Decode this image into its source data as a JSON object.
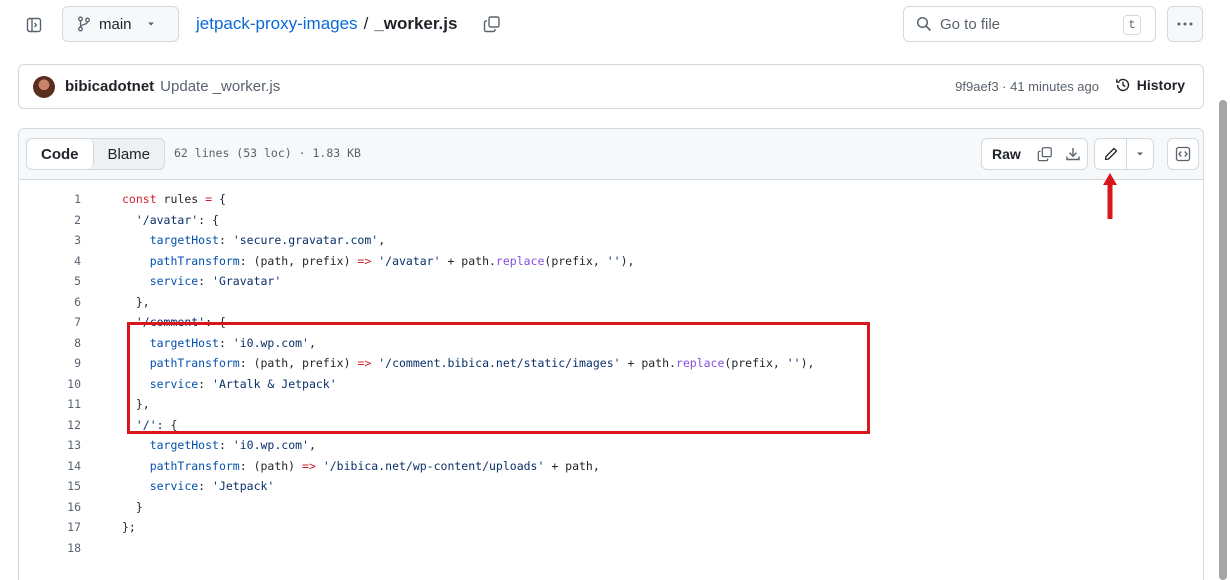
{
  "topbar": {
    "branch": "main",
    "repo": "jetpack-proxy-images",
    "separator": "/",
    "file": "_worker.js",
    "search_placeholder": "Go to file",
    "search_shortcut": "t"
  },
  "commit": {
    "author": "bibicadotnet",
    "message": "Update _worker.js",
    "meta": "9f9aef3 · 41 minutes ago",
    "history_label": "History"
  },
  "file_header": {
    "code_tab": "Code",
    "blame_tab": "Blame",
    "info": "62 lines (53 loc) · 1.83 KB",
    "raw_label": "Raw"
  },
  "code_lines": [
    {
      "n": "1",
      "text": "const rules = {"
    },
    {
      "n": "2",
      "text": "  '/avatar': {"
    },
    {
      "n": "3",
      "text": "    targetHost: 'secure.gravatar.com',"
    },
    {
      "n": "4",
      "text": "    pathTransform: (path, prefix) => '/avatar' + path.replace(prefix, ''),"
    },
    {
      "n": "5",
      "text": "    service: 'Gravatar'"
    },
    {
      "n": "6",
      "text": "  },"
    },
    {
      "n": "7",
      "text": "  '/comment': {"
    },
    {
      "n": "8",
      "text": "    targetHost: 'i0.wp.com',"
    },
    {
      "n": "9",
      "text": "    pathTransform: (path, prefix) => '/comment.bibica.net/static/images' + path.replace(prefix, ''),"
    },
    {
      "n": "10",
      "text": "    service: 'Artalk & Jetpack'"
    },
    {
      "n": "11",
      "text": "  },"
    },
    {
      "n": "12",
      "text": "  '/': {"
    },
    {
      "n": "13",
      "text": "    targetHost: 'i0.wp.com',"
    },
    {
      "n": "14",
      "text": "    pathTransform: (path) => '/bibica.net/wp-content/uploads' + path,"
    },
    {
      "n": "15",
      "text": "    service: 'Jetpack'"
    },
    {
      "n": "16",
      "text": "  }"
    },
    {
      "n": "17",
      "text": "};"
    },
    {
      "n": "18",
      "text": ""
    }
  ],
  "colors": {
    "link": "#0969da",
    "keyword": "#cf222e",
    "string": "#0a3069",
    "property": "#0550ae",
    "function": "#8250df",
    "annotation": "#d9161c"
  }
}
